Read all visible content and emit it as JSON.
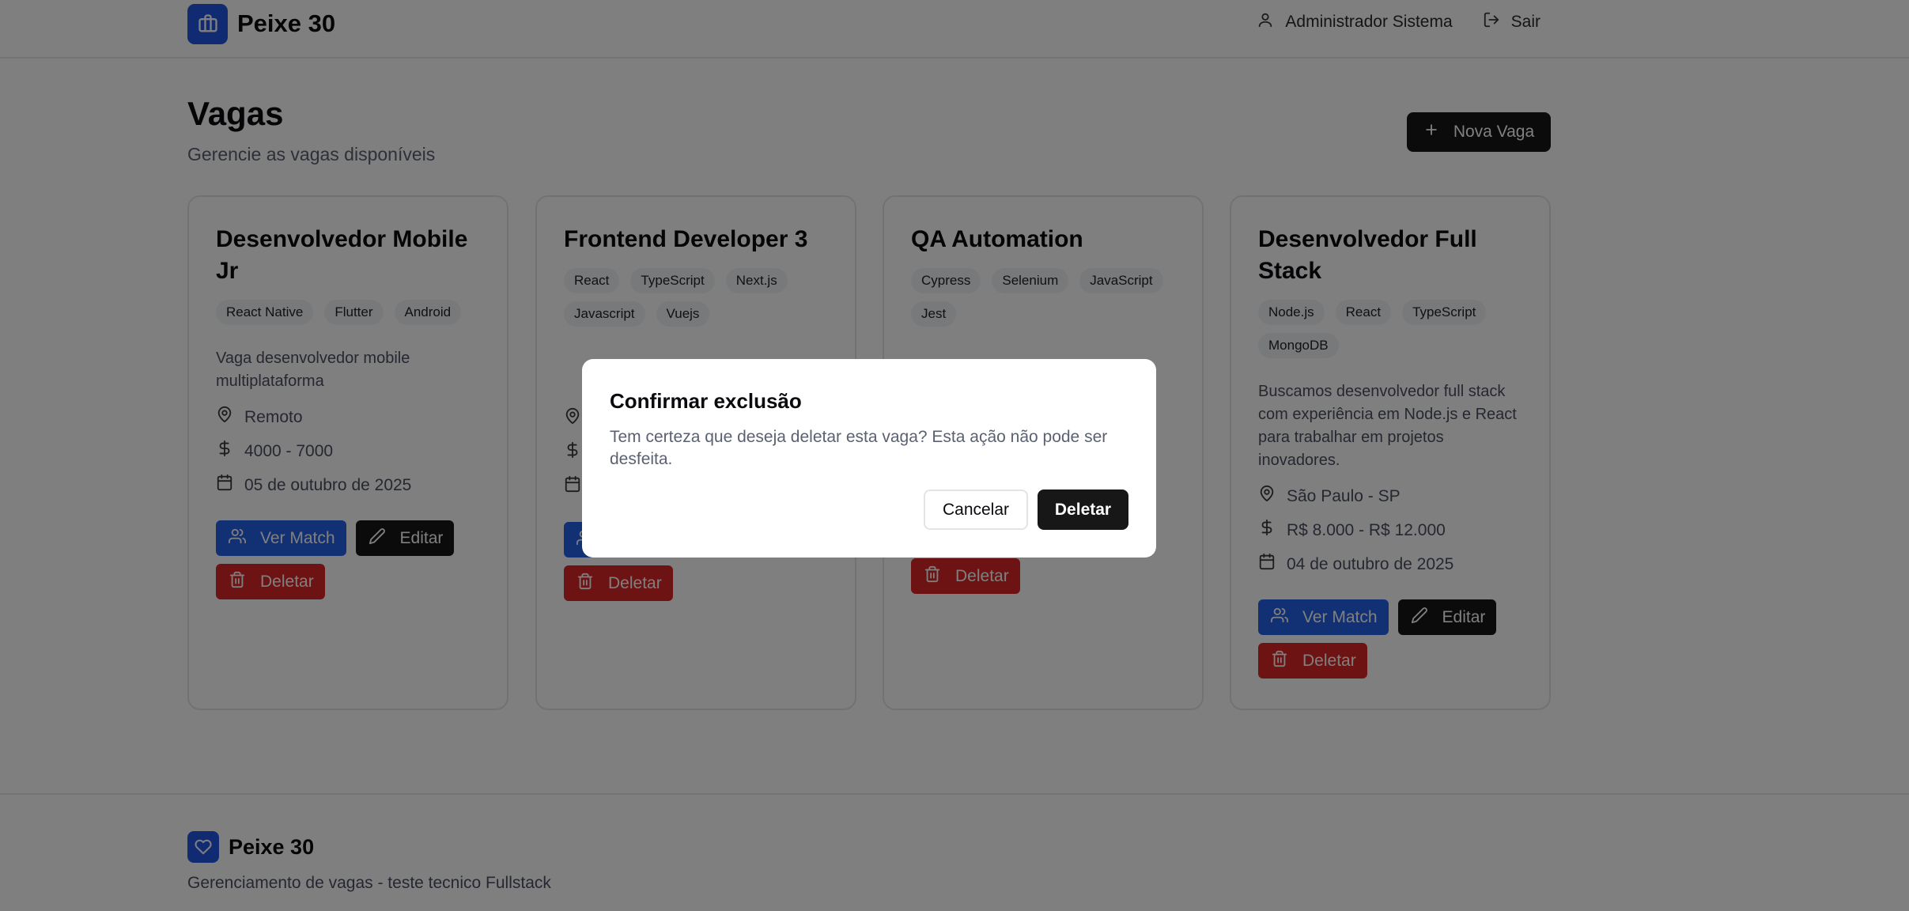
{
  "header": {
    "brand": "Peixe 30",
    "user_label": "Administrador Sistema",
    "logout_label": "Sair"
  },
  "page": {
    "title": "Vagas",
    "subtitle": "Gerencie as vagas disponíveis",
    "new_button": "Nova Vaga"
  },
  "actions": {
    "match": "Ver Match",
    "edit": "Editar",
    "delete": "Deletar"
  },
  "jobs": [
    {
      "title": "Desenvolvedor Mobile Jr",
      "tags": [
        "React Native",
        "Flutter",
        "Android"
      ],
      "description": "Vaga desenvolvedor mobile multiplataforma",
      "location": "Remoto",
      "salary": "4000 - 7000",
      "date": "05 de outubro de 2025"
    },
    {
      "title": "Frontend Developer 3",
      "tags": [
        "React",
        "TypeScript",
        "Next.js",
        "Javascript",
        "Vuejs"
      ]
    },
    {
      "title": "QA Automation",
      "tags": [
        "Cypress",
        "Selenium",
        "JavaScript",
        "Jest"
      ]
    },
    {
      "title": "Desenvolvedor Full Stack",
      "tags": [
        "Node.js",
        "React",
        "TypeScript",
        "MongoDB"
      ],
      "description": "Buscamos desenvolvedor full stack com experiência em Node.js e React para trabalhar em projetos inovadores.",
      "location": "São Paulo - SP",
      "salary": "R$ 8.000 - R$ 12.000",
      "date": "04 de outubro de 2025"
    }
  ],
  "modal": {
    "title": "Confirmar exclusão",
    "message": "Tem certeza que deseja deletar esta vaga? Esta ação não pode ser desfeita.",
    "cancel": "Cancelar",
    "confirm": "Deletar"
  },
  "footer": {
    "brand": "Peixe 30",
    "text": "Gerenciamento de vagas - teste tecnico Fullstack"
  },
  "colors": {
    "brand_blue": "#2056e3",
    "match_blue": "#2563eb",
    "dark": "#171717",
    "danger": "#dc2626",
    "overlay": "rgba(0,0,0,0.5)"
  },
  "icons": [
    "briefcase-icon",
    "user-icon",
    "logout-icon",
    "plus-icon",
    "map-pin-icon",
    "dollar-icon",
    "calendar-icon",
    "users-icon",
    "pencil-icon",
    "trash-icon",
    "heart-icon"
  ]
}
